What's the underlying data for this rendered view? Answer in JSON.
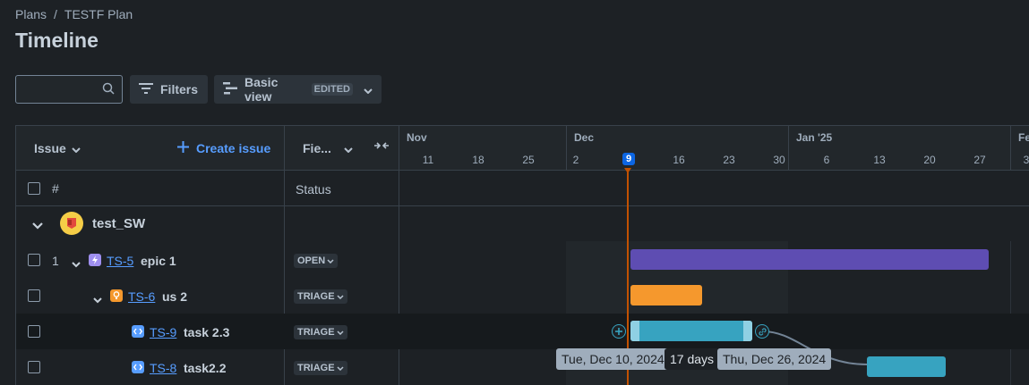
{
  "breadcrumb": {
    "root": "Plans",
    "separator": "/",
    "current": "TESTF Plan"
  },
  "page_title": "Timeline",
  "toolbar": {
    "search_placeholder": "",
    "filters_label": "Filters",
    "view_label": "Basic view",
    "view_badge": "EDITED"
  },
  "columns": {
    "issue_label": "Issue",
    "create_issue_label": "Create issue",
    "fields_label": "Fie...",
    "hash_label": "#",
    "status_label": "Status"
  },
  "timeline": {
    "months": [
      "Nov",
      "Dec",
      "Jan '25",
      "Fe"
    ],
    "days": [
      "11",
      "18",
      "25",
      "2",
      "9",
      "16",
      "23",
      "30",
      "6",
      "13",
      "20",
      "27",
      "3"
    ],
    "today": "9"
  },
  "group": {
    "name": "test_SW"
  },
  "rows": [
    {
      "num": "1",
      "key": "TS-5",
      "summary": "epic 1",
      "status": "OPEN",
      "type": "epic"
    },
    {
      "num": "",
      "key": "TS-6",
      "summary": "us 2",
      "status": "TRIAGE",
      "type": "story"
    },
    {
      "num": "",
      "key": "TS-9",
      "summary": "task 2.3",
      "status": "TRIAGE",
      "type": "task"
    },
    {
      "num": "",
      "key": "TS-8",
      "summary": "task2.2",
      "status": "TRIAGE",
      "type": "task"
    }
  ],
  "tooltip": {
    "start": "Tue, Dec 10, 2024",
    "duration": "17 days",
    "end": "Thu, Dec 26, 2024"
  },
  "colors": {
    "epic_bar": "#5e4db2",
    "story_bar": "#f5982d",
    "task_bar": "#37a3c0",
    "today_line": "#c25100",
    "link": "#579dff"
  }
}
